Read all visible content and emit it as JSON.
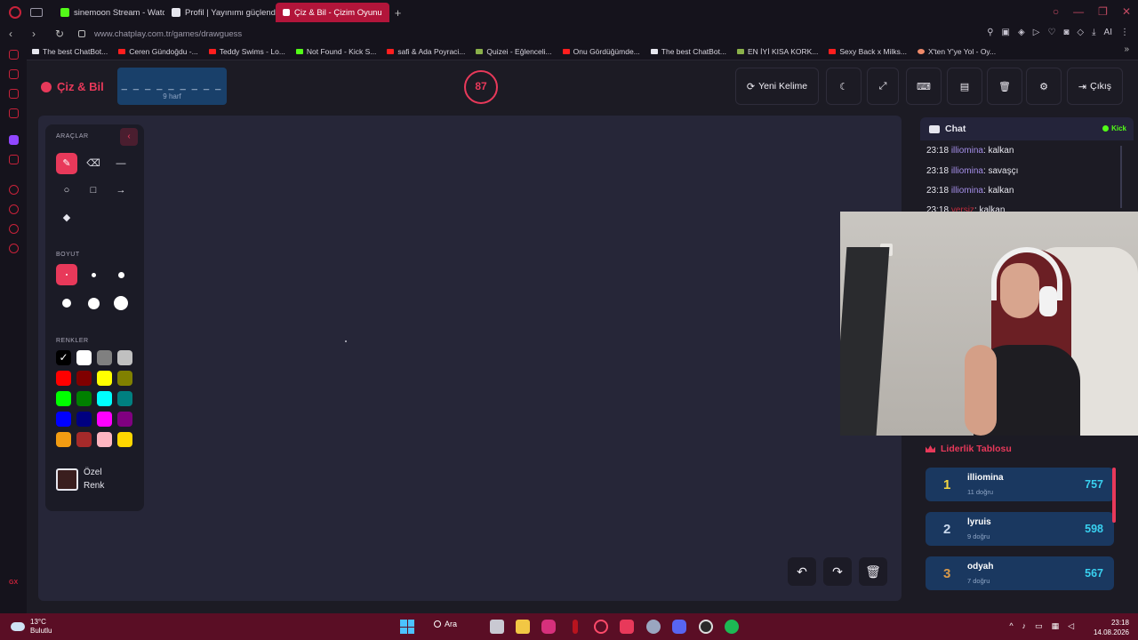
{
  "browser": {
    "tabs": [
      {
        "label": "sinemoon Stream - Watch"
      },
      {
        "label": "Profil | Yayınımı güçlendirme"
      },
      {
        "label": "Çiz & Bil - Çizim Oyunu",
        "active": true
      }
    ],
    "url": "www.chatplay.com.tr/games/drawguess",
    "addr_badge": "AI",
    "bookmarks": [
      "The best ChatBot...",
      "Ceren Gündoğdu -...",
      "Teddy Swims - Lo...",
      "Not Found - Kick S...",
      "safi & Ada Poyraci...",
      "Quizei - Eğlenceli...",
      "Onu Gördüğümde...",
      "The best ChatBot...",
      "EN İYİ KISA KORK...",
      "Sexy Back x Milks...",
      "X'ten Y'ye Yol - Oy..."
    ],
    "sidebar_label": "GX"
  },
  "header": {
    "logo": "Çiz & Bil",
    "word_dashes": "_ _ _ _ _ _ _ _ _",
    "word_hint": "9 harf",
    "timer": "87",
    "buttons": {
      "new_word": "Yeni Kelime",
      "exit": "Çıkış"
    }
  },
  "tools": {
    "title": "ARAÇLAR",
    "size_title": "BOYUT",
    "colors_title": "RENKLER",
    "custom_label_1": "Özel",
    "custom_label_2": "Renk",
    "palette": [
      "#000000",
      "#ffffff",
      "#808080",
      "#c0c0c0",
      "#ff0000",
      "#800000",
      "#ffff00",
      "#808000",
      "#00ff00",
      "#008000",
      "#00ffff",
      "#008080",
      "#0000ff",
      "#000080",
      "#ff00ff",
      "#800080",
      "#f39c12",
      "#a52a2a",
      "#ffb6c1",
      "#ffd700"
    ],
    "accent": "#e8395a"
  },
  "chat": {
    "title": "Chat",
    "platform": "Kick",
    "messages": [
      {
        "time": "23:18",
        "user": "illiomina",
        "text": ": kalkan"
      },
      {
        "time": "23:18",
        "user": "illiomina",
        "text": ": savaşçı"
      },
      {
        "time": "23:18",
        "user": "illiomina",
        "text": ": kalkan"
      },
      {
        "time": "23:18",
        "user": "yersiz",
        "text": ": kalkan"
      }
    ]
  },
  "leaderboard": {
    "title": "Liderlik Tablosu",
    "rows": [
      {
        "rank": "1",
        "name": "illiomina",
        "sub": "11 doğru",
        "score": "757",
        "rank_color": "#f5d742"
      },
      {
        "rank": "2",
        "name": "lyruis",
        "sub": "9 doğru",
        "score": "598",
        "rank_color": "#c9d8ec"
      },
      {
        "rank": "3",
        "name": "odyah",
        "sub": "7 doğru",
        "score": "567",
        "rank_color": "#d99a4a"
      }
    ]
  },
  "taskbar": {
    "temp": "13°C",
    "weather": "Bulutlu",
    "search": "Ara",
    "time": "23:18",
    "date": "14.08.2026"
  }
}
